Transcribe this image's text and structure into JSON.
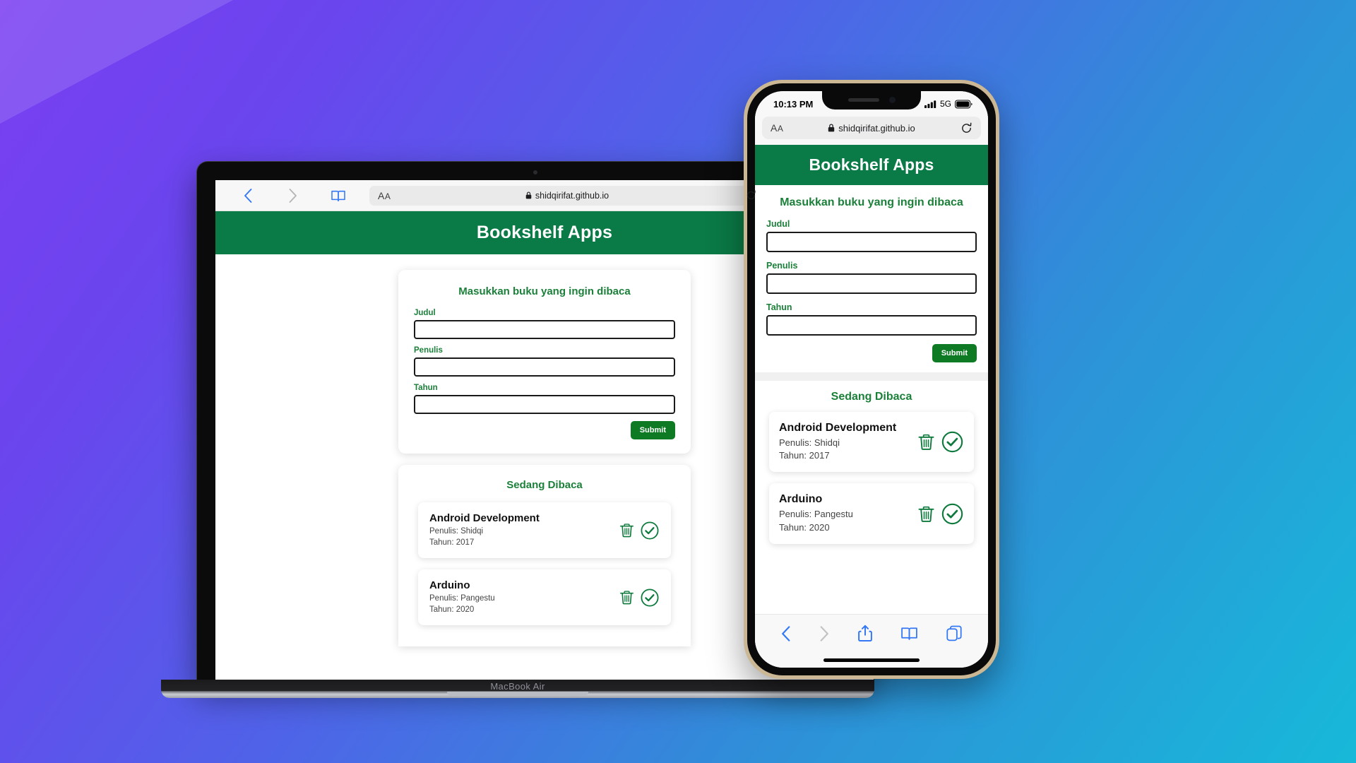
{
  "background": {
    "gradient_from": "#7b3ff2",
    "gradient_to": "#17b9d9",
    "accent_wedge": "rgba(255,255,255,0.13)"
  },
  "colors": {
    "brand_green": "#0a7a46",
    "heading_green": "#1b8039",
    "submit_green": "#0f7a24",
    "icon_green": "#0f7a3d",
    "ios_blue": "#3478f6"
  },
  "laptop": {
    "device_label": "MacBook Air",
    "browser": {
      "back_icon": "chevron-left-icon",
      "forward_icon": "chevron-right-icon",
      "sidebar_icon": "book-icon",
      "text_size_label": "AA",
      "lock_icon": "lock-icon",
      "url": "shidqirifat.github.io",
      "reload_icon": "reload-icon",
      "share_icon": "share-icon",
      "newtab_icon": "plus-icon"
    },
    "app": {
      "header_title": "Bookshelf Apps",
      "form": {
        "title": "Masukkan buku yang ingin dibaca",
        "fields": [
          {
            "label": "Judul",
            "value": "",
            "placeholder": ""
          },
          {
            "label": "Penulis",
            "value": "",
            "placeholder": ""
          },
          {
            "label": "Tahun",
            "value": "",
            "placeholder": ""
          }
        ],
        "submit_label": "Submit"
      },
      "list": {
        "title": "Sedang Dibaca",
        "books": [
          {
            "title": "Android Development",
            "author": "Penulis: Shidqi",
            "year": "Tahun: 2017",
            "delete_icon": "trash-icon",
            "done_icon": "check-circle-icon"
          },
          {
            "title": "Arduino",
            "author": "Penulis: Pangestu",
            "year": "Tahun: 2020",
            "delete_icon": "trash-icon",
            "done_icon": "check-circle-icon"
          }
        ]
      }
    }
  },
  "phone": {
    "statusbar": {
      "time": "10:13 PM",
      "signal_icon": "cellular-bars-icon",
      "network": "5G",
      "battery_icon": "battery-icon"
    },
    "browser": {
      "text_size_label": "AA",
      "lock_icon": "lock-icon",
      "url": "shidqirifat.github.io",
      "reload_icon": "reload-icon"
    },
    "app": {
      "header_title": "Bookshelf Apps",
      "form": {
        "title": "Masukkan buku yang ingin dibaca",
        "fields": [
          {
            "label": "Judul",
            "value": "",
            "placeholder": ""
          },
          {
            "label": "Penulis",
            "value": "",
            "placeholder": ""
          },
          {
            "label": "Tahun",
            "value": "",
            "placeholder": ""
          }
        ],
        "submit_label": "Submit"
      },
      "list": {
        "title": "Sedang Dibaca",
        "books": [
          {
            "title": "Android Development",
            "author": "Penulis: Shidqi",
            "year": "Tahun: 2017",
            "delete_icon": "trash-icon",
            "done_icon": "check-circle-icon"
          },
          {
            "title": "Arduino",
            "author": "Penulis: Pangestu",
            "year": "Tahun: 2020",
            "delete_icon": "trash-icon",
            "done_icon": "check-circle-icon"
          }
        ]
      }
    },
    "tabbar": {
      "back_icon": "chevron-left-icon",
      "forward_icon": "chevron-right-icon",
      "share_icon": "share-icon",
      "bookmarks_icon": "book-icon",
      "tabs_icon": "tabs-icon"
    }
  }
}
